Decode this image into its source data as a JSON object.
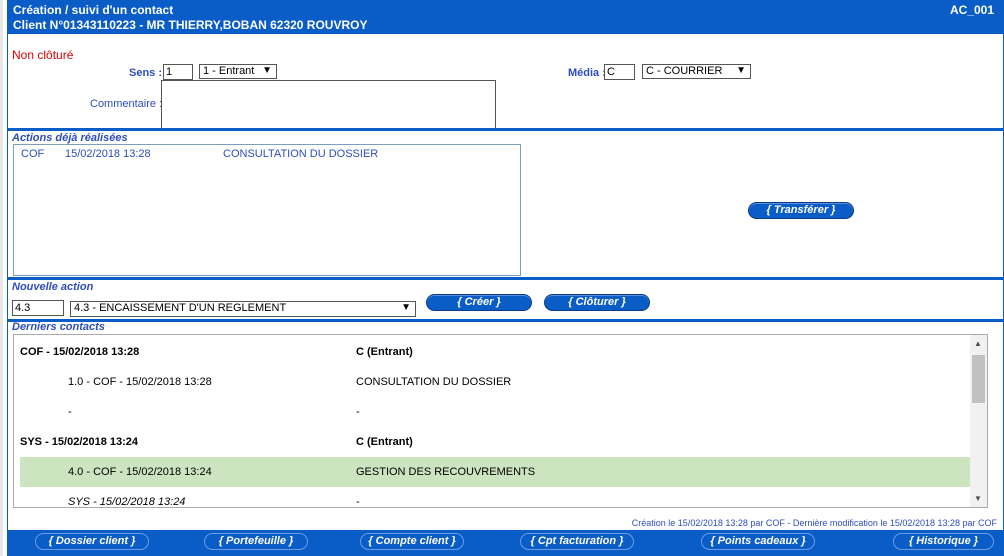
{
  "header": {
    "title": "Création / suivi d'un contact",
    "client": "Client N°01343110223 - MR THIERRY,BOBAN 62320 ROUVROY",
    "code": "AC_001"
  },
  "form": {
    "status": "Non clôturé",
    "sens_label": "Sens :",
    "sens_value": "1",
    "sens_select": "1 - Entrant",
    "media_label": "Média :",
    "media_value": "C",
    "media_select": "C - COURRIER",
    "comment_label": "Commentaire :",
    "comment_value": ""
  },
  "actions": {
    "title": "Actions déjà réalisées",
    "rows": [
      {
        "code": "COF",
        "date": "15/02/2018 13:28",
        "label": "CONSULTATION DU DOSSIER"
      }
    ],
    "transfer_button": "{ Transférer }"
  },
  "new_action": {
    "title": "Nouvelle action",
    "code_value": "4.3",
    "select_value": "4.3 - ENCAISSEMENT D'UN REGLEMENT",
    "create_button": "{ Créer }",
    "close_button": "{ Clôturer }"
  },
  "contacts": {
    "title": "Derniers contacts",
    "rows": [
      {
        "left": "COF - 15/02/2018 13:28",
        "right": "C (Entrant)",
        "style": "bold"
      },
      {
        "left": "1.0 - COF - 15/02/2018 13:28",
        "right": "CONSULTATION DU DOSSIER",
        "style": "indent"
      },
      {
        "left": "-",
        "right": "-",
        "style": "indent"
      },
      {
        "left": "SYS - 15/02/2018 13:24",
        "right": "C (Entrant)",
        "style": "bold"
      },
      {
        "left": "4.0 - COF - 15/02/2018 13:24",
        "right": "GESTION DES RECOUVREMENTS",
        "style": "green"
      },
      {
        "left": "SYS - 15/02/2018 13:24",
        "right": "-",
        "style": "ital"
      }
    ]
  },
  "footer_note": "Création le 15/02/2018 13:28 par COF - Dernière modification le 15/02/2018 13:28 par COF",
  "bottom_buttons": [
    "{ Dossier client }",
    "{ Portefeuille }",
    "{ Compte client }",
    "{ Cpt facturation }",
    "{ Points cadeaux }",
    "{ Historique }"
  ],
  "colors": {
    "brand": "#0a5cc6",
    "label": "#2d4dbf",
    "status": "#e00000",
    "highlight": "#cce4c0"
  }
}
